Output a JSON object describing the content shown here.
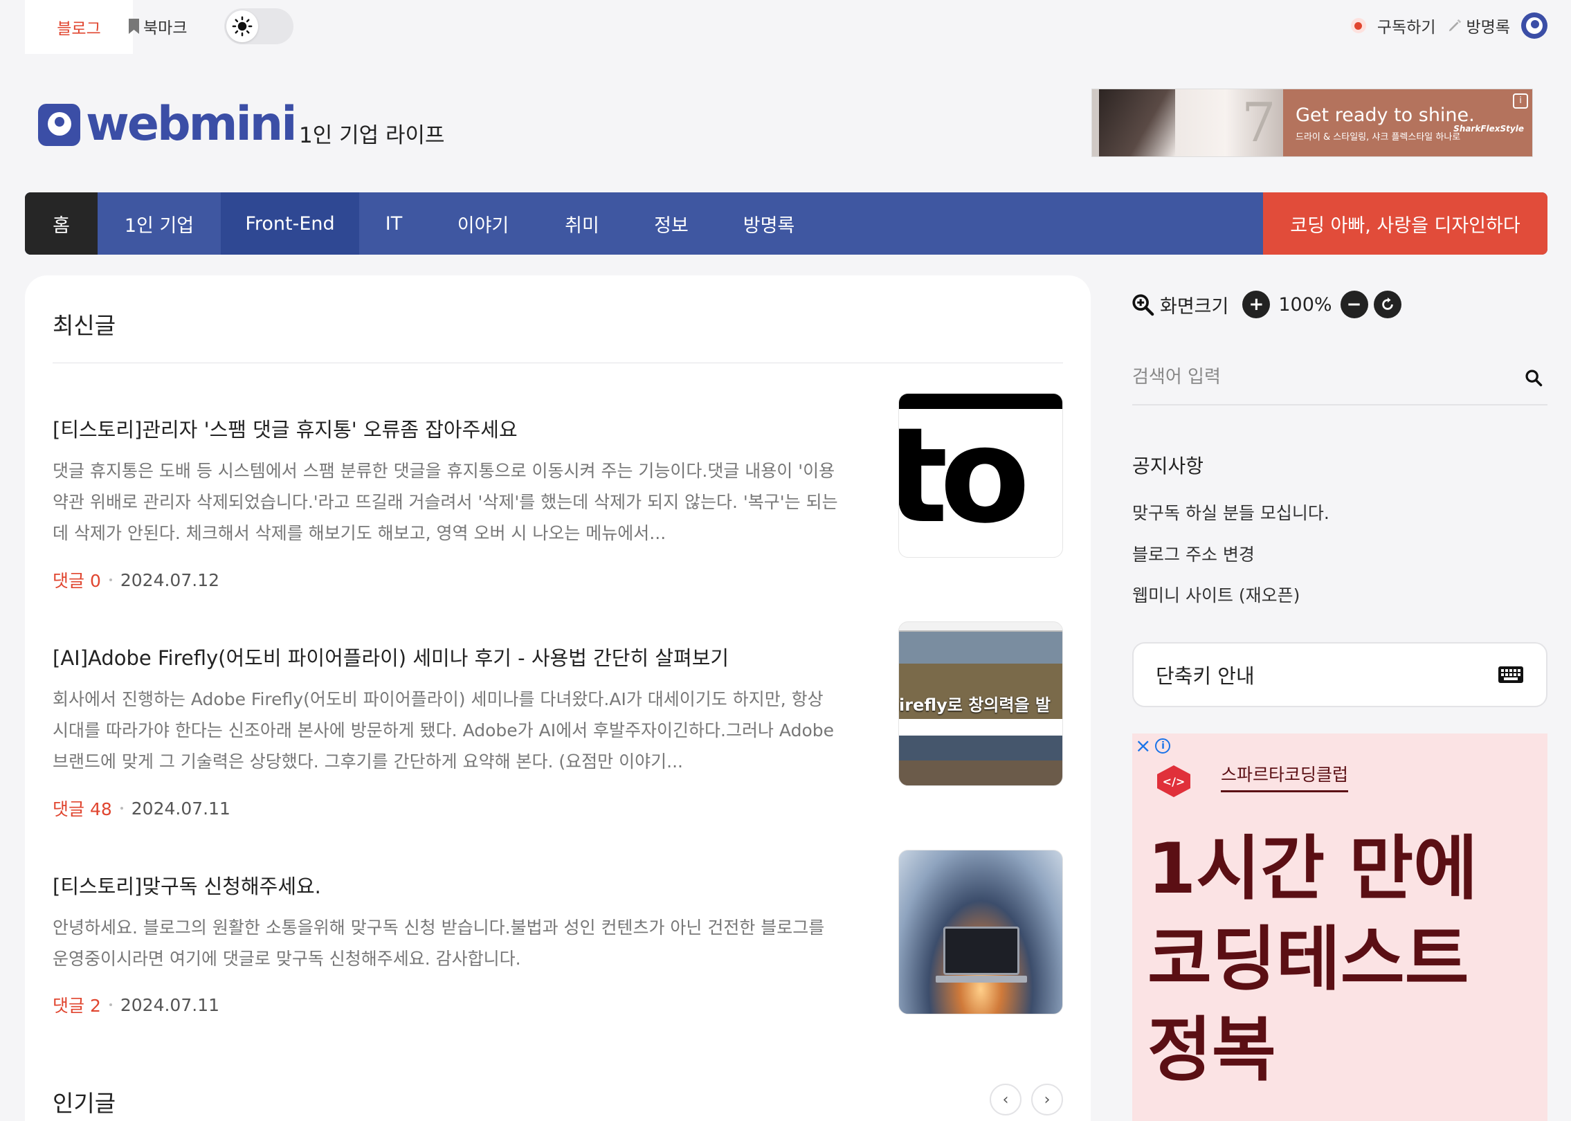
{
  "topbar": {
    "blog_tab": "블로그",
    "bookmark_tab": "북마크",
    "subscribe": "구독하기",
    "guestbook": "방명록"
  },
  "header": {
    "logo_text": "webmini",
    "tagline": "1인 기업 라이프"
  },
  "ad_banner": {
    "headline": "Get ready to shine.",
    "subtext": "드라이 & 스타일링, 샤크 플렉스타일 하나로",
    "brand": "SharkFlexStyle"
  },
  "nav": {
    "home": "홈",
    "items": [
      "1인 기업",
      "Front-End",
      "IT",
      "이야기",
      "취미",
      "정보",
      "방명록"
    ],
    "active": "Front-End",
    "promo": "코딩 아빠, 사랑을 디자인하다"
  },
  "main": {
    "recent_title": "최신글",
    "popular_title": "인기글",
    "posts": [
      {
        "title": "[티스토리]관리자 '스팸 댓글 휴지통' 오류좀 잡아주세요",
        "excerpt": "댓글 휴지통은 도배 등 시스템에서 스팸 분류한 댓글을 휴지통으로 이동시켜 주는 기능이다.댓글 내용이 '이용약관 위배로 관리자 삭제되었습니다.'라고 뜨길래 거슬려서 '삭제'를 했는데 삭제가 되지 않는다. '복구'는 되는데 삭제가 안된다. 체크해서 삭제를 해보기도 해보고, 영역 오버 시 나오는 메뉴에서...",
        "comments": "댓글 0",
        "date": "2024.07.12",
        "thumb_text": "to"
      },
      {
        "title": "[AI]Adobe Firefly(어도비 파이어플라이) 세미나 후기 - 사용법 간단히 살펴보기",
        "excerpt": "회사에서 진행하는 Adobe Firefly(어도비 파이어플라이) 세미나를 다녀왔다.AI가 대세이기도 하지만, 항상 시대를 따라가야 한다는 신조아래 본사에 방문하게 됐다. Adobe가 AI에서 후발주자이긴하다.그러나 Adobe 브랜드에 맞게 그 기술력은 상당했다. 그후기를 간단하게 요약해 본다. (요점만 이야기...",
        "comments": "댓글 48",
        "date": "2024.07.11",
        "thumb_text": "irefly로 창의력을 발"
      },
      {
        "title": "[티스토리]맞구독 신청해주세요.",
        "excerpt": "안녕하세요. 블로그의 원활한 소통을위해 맞구독 신청 받습니다.불법과 성인 컨텐츠가 아닌 건전한 블로그를 운영중이시라면 여기에 댓글로 맞구독 신청해주세요. 감사합니다.",
        "comments": "댓글 2",
        "date": "2024.07.11"
      }
    ]
  },
  "sidebar": {
    "zoom_label": "화면크기",
    "zoom_value": "100%",
    "search_placeholder": "검색어 입력",
    "notice_title": "공지사항",
    "notices": [
      "맞구독 하실 분들 모십니다.",
      "블로그 주소 변경",
      "웹미니 사이트 (재오픈)"
    ],
    "shortcut_label": "단축키 안내"
  },
  "side_ad": {
    "brand": "스파르타코딩클럽",
    "headline": "1시간 만에 코딩테스트 정복"
  },
  "colors": {
    "brand_blue": "#3f57a1",
    "accent_red": "#e0452f",
    "promo_red": "#e14c3a",
    "ad_bg": "#fbe3e4",
    "ad_text": "#5b0f14"
  },
  "icons": [
    "bookmark-icon",
    "sun-icon",
    "record-icon",
    "pen-icon",
    "avatar-icon",
    "zoom-icon",
    "plus-icon",
    "minus-icon",
    "reset-icon",
    "search-icon",
    "keyboard-icon",
    "chevron-left-icon",
    "chevron-right-icon",
    "close-icon",
    "info-icon"
  ]
}
